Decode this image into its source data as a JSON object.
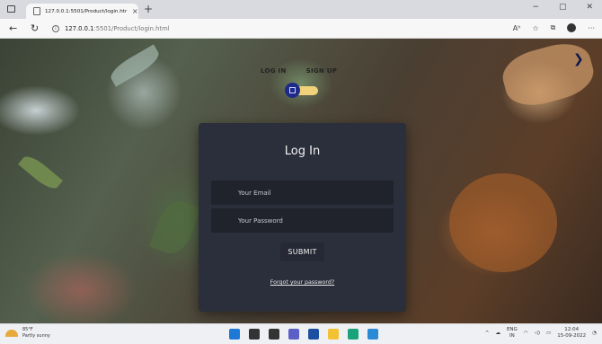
{
  "browser": {
    "tab_title": "127.0.0.1:5501/Product/login.htr",
    "tab_close": "×",
    "new_tab": "+",
    "window": {
      "minimize": "−",
      "maximize": "▢",
      "close": "✕"
    },
    "nav": {
      "back": "←",
      "refresh": "↻"
    },
    "url_host": "127.0.0.1",
    "url_path": ":5501/Product/login.html",
    "toolbar": {
      "read_aloud": "Aʰ",
      "favorites": "☆",
      "collections": "⧉",
      "more": "···"
    }
  },
  "page": {
    "switch": {
      "login_label": "LOG IN",
      "signup_label": "SIGN UP"
    },
    "next_icon": "❯",
    "card": {
      "title": "Log In",
      "email_placeholder": "Your Email",
      "password_placeholder": "Your Password",
      "submit_label": "SUBMIT",
      "forgot_link": "Forgot your password?"
    }
  },
  "taskbar": {
    "weather": {
      "temp": "85°F",
      "condition": "Partly sunny"
    },
    "apps": [
      {
        "name": "start",
        "color": "#1e78d6"
      },
      {
        "name": "search",
        "color": "#333333"
      },
      {
        "name": "task-view",
        "color": "#333333"
      },
      {
        "name": "chat",
        "color": "#5b5fc7"
      },
      {
        "name": "widgets",
        "color": "#1d4fa0"
      },
      {
        "name": "file-explorer",
        "color": "#f2c233"
      },
      {
        "name": "edge",
        "color": "#1aa37a"
      },
      {
        "name": "vscode",
        "color": "#2a8ad4"
      }
    ],
    "tray": {
      "chevron": "^",
      "lang_top": "ENG",
      "lang_bottom": "IN",
      "time": "12:04",
      "date": "15-09-2022"
    }
  }
}
